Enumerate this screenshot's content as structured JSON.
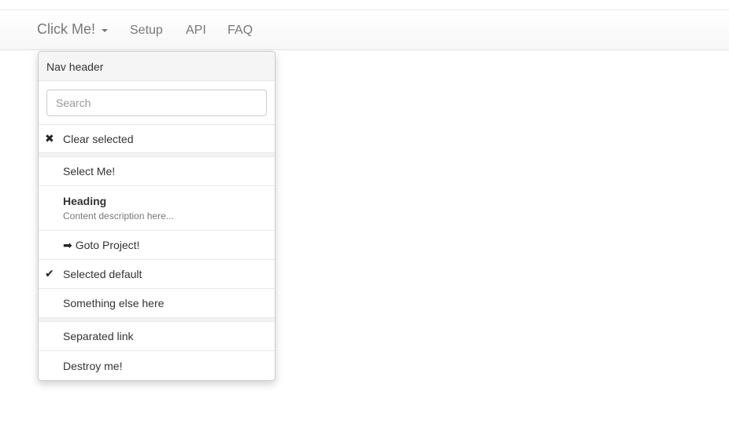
{
  "navbar": {
    "brand_label": "Click Me!",
    "links": [
      "Setup",
      "API",
      "FAQ"
    ]
  },
  "dropdown": {
    "header": "Nav header",
    "search_placeholder": "Search",
    "items": [
      {
        "label": "Clear selected",
        "icon": "times-icon"
      },
      {
        "label": "Select Me!"
      },
      {
        "label": "Heading",
        "description": "Content description here..."
      },
      {
        "label": "Goto Project!",
        "icon": "arrow-right-icon"
      },
      {
        "label": "Selected default",
        "icon": "check-icon"
      },
      {
        "label": "Something else here"
      },
      {
        "label": "Separated link"
      },
      {
        "label": "Destroy me!"
      }
    ]
  },
  "icons": {
    "times": "✖",
    "arrow_right": "➡",
    "check": "✔"
  },
  "colors": {
    "text": "#333333",
    "muted": "#777777",
    "border": "#cccccc",
    "header_bg": "#f5f5f5"
  }
}
